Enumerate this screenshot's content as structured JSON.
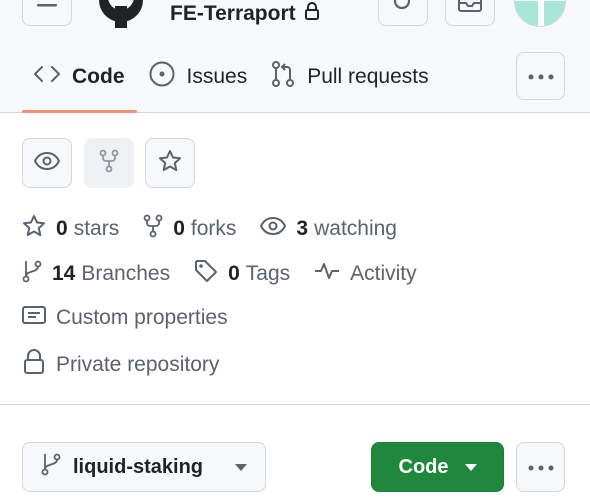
{
  "colors": {
    "accent_underline": "#fd8c73",
    "primary_button": "#1f883d",
    "header_bg": "#f6f8fa",
    "muted_text": "#59636e",
    "border": "#d0d7de"
  },
  "header": {
    "repo_name": "FE-Terraport",
    "repo_lock_icon": "lock-icon",
    "icons": [
      "hamburger-icon",
      "github-logo-icon",
      "search-icon",
      "inbox-icon",
      "avatar"
    ]
  },
  "tabs": [
    {
      "label": "Code",
      "icon": "code-icon",
      "active": true
    },
    {
      "label": "Issues",
      "icon": "issue-opened-icon",
      "active": false
    },
    {
      "label": "Pull requests",
      "icon": "git-pull-request-icon",
      "active": false
    }
  ],
  "actions": {
    "watch_icon": "eye-icon",
    "fork_icon": "repo-forked-icon",
    "star_icon": "star-icon",
    "more_icon": "kebab-horizontal-icon"
  },
  "stats": {
    "stars_count": "0",
    "stars_label": "stars",
    "forks_count": "0",
    "forks_label": "forks",
    "watching_count": "3",
    "watching_label": "watching",
    "branches_count": "14",
    "branches_label": "Branches",
    "tags_count": "0",
    "tags_label": "Tags",
    "activity_label": "Activity"
  },
  "properties": {
    "custom_properties_label": "Custom properties",
    "visibility_label": "Private repository"
  },
  "toolbar": {
    "branch_name": "liquid-staking",
    "code_button_label": "Code"
  }
}
